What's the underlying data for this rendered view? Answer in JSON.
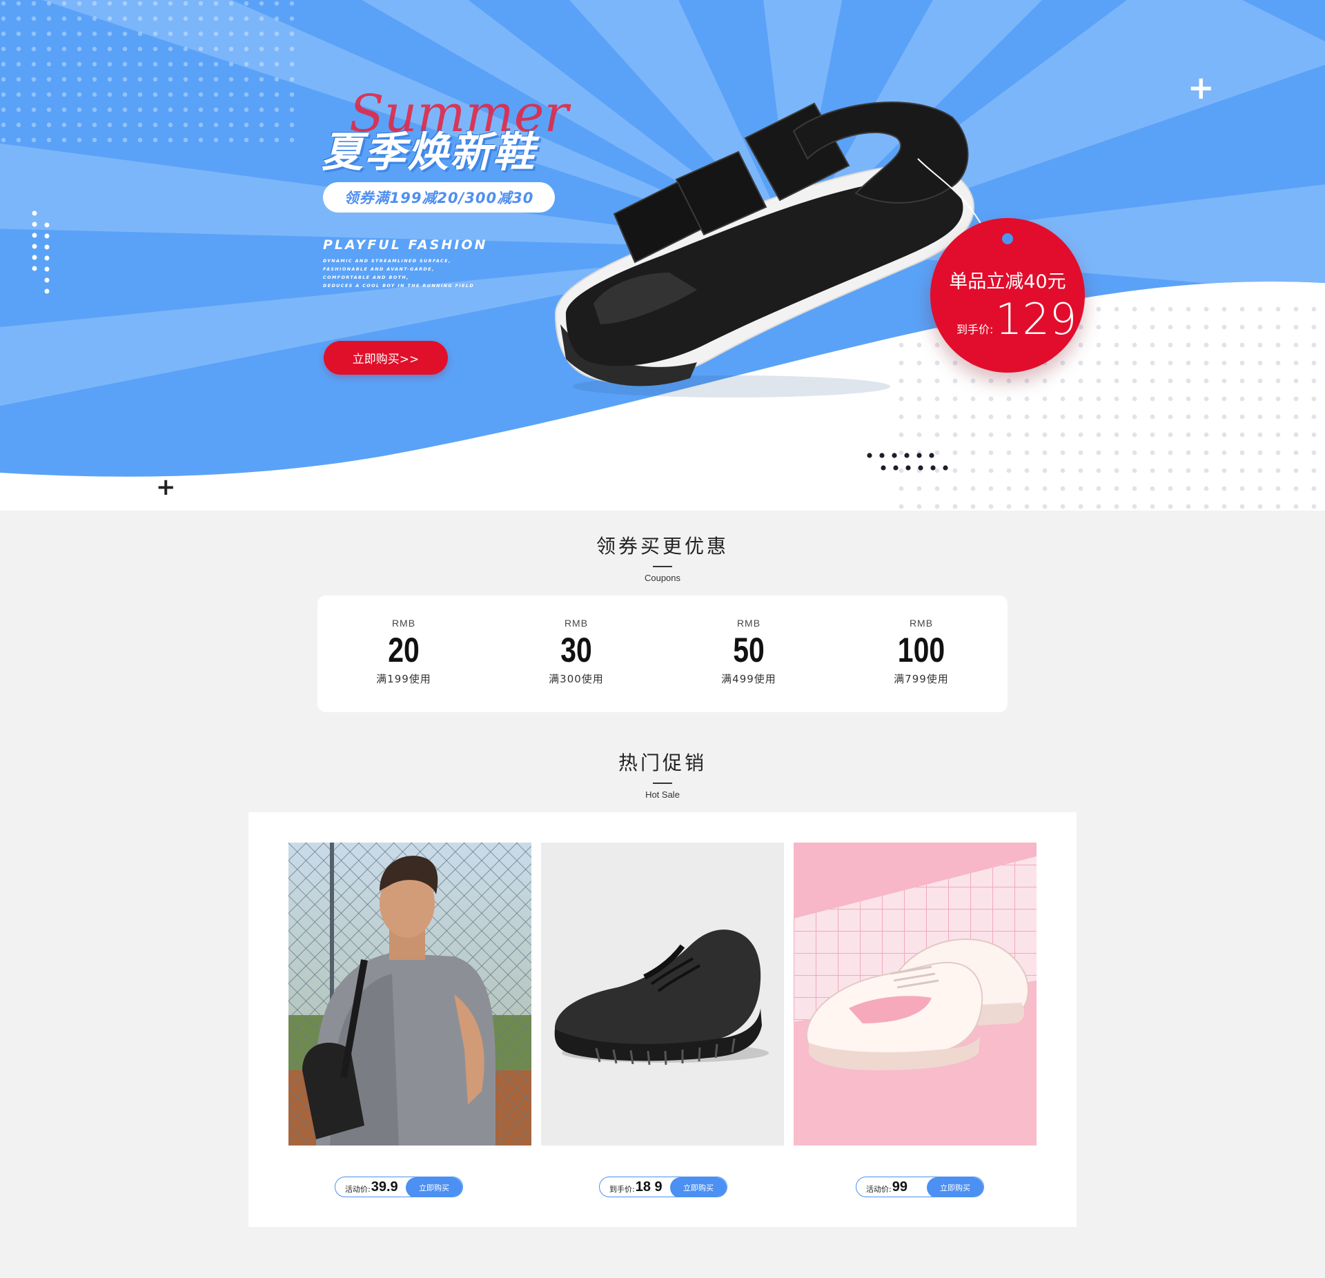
{
  "hero": {
    "title": "夏季焕新鞋",
    "script": "Summer",
    "coupon_pill": "领券满199减20/300减30",
    "subtitle": "PLAYFUL FASHION",
    "desc_lines": [
      "DYNAMIC AND STREAMLINED SURFACE,",
      "FASHIONABLE AND AVANT-GARDE,",
      "COMFORTABLE AND BOTH,",
      "DEDUCES A COOL BOY IN THE RUNNING FIELD"
    ],
    "buy_button": "立即购买>>",
    "tag_line1": "单品立减40元",
    "tag_price_label": "到手价:",
    "tag_price": "129",
    "plus": "+"
  },
  "coupons_section": {
    "title": "领券买更优惠",
    "subtitle": "Coupons",
    "items": [
      {
        "currency": "RMB",
        "amount": "20",
        "condition": "满199使用"
      },
      {
        "currency": "RMB",
        "amount": "30",
        "condition": "满300使用"
      },
      {
        "currency": "RMB",
        "amount": "50",
        "condition": "满499使用"
      },
      {
        "currency": "RMB",
        "amount": "100",
        "condition": "满799使用"
      }
    ]
  },
  "hot_section": {
    "title": "热门促销",
    "subtitle": "Hot Sale",
    "products": [
      {
        "price_label": "活动价:",
        "price": "39.9",
        "button": "立即购买"
      },
      {
        "price_label": "到手价:",
        "price": "18 9",
        "button": "立即购买"
      },
      {
        "price_label": "活动价:",
        "price": "99",
        "button": "立即购买"
      }
    ]
  },
  "colors": {
    "hero_blue": "#5aa2f7",
    "accent_red": "#e20d2c",
    "pill_blue": "#4b90f2"
  }
}
